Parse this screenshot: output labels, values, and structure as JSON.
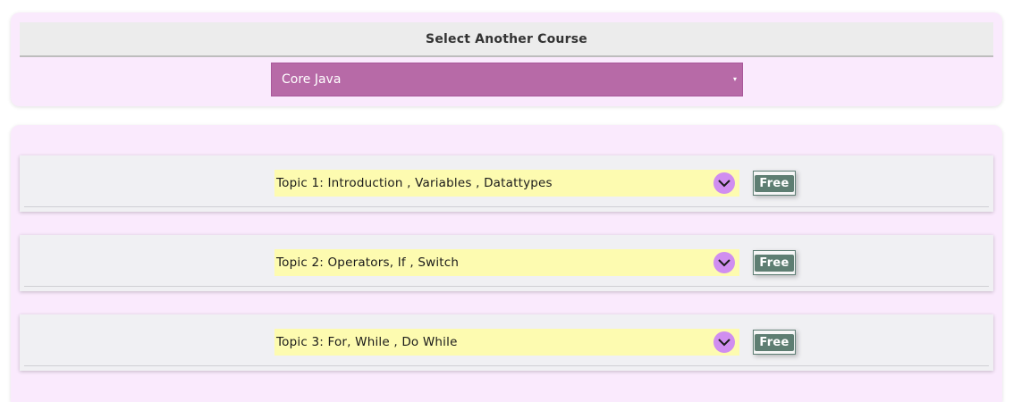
{
  "course_selector": {
    "heading": "Select Another Course",
    "selected_course": "Core Java",
    "caret": "▾"
  },
  "topics": [
    {
      "label": "Topic 1: Introduction , Variables , Datattypes",
      "badge": "Free"
    },
    {
      "label": "Topic 2: Operators, If , Switch",
      "badge": "Free"
    },
    {
      "label": "Topic 3: For, While , Do While",
      "badge": "Free"
    }
  ],
  "colors": {
    "panel_background": "#faeafd",
    "select_background": "#b76aa7",
    "topic_bar": "#fdfbb0",
    "chevron_circle": "#d08ef0",
    "free_badge": "#5e7e72"
  },
  "icons": {
    "expand": "chevron-down-icon",
    "select_caret": "caret-down-icon"
  }
}
